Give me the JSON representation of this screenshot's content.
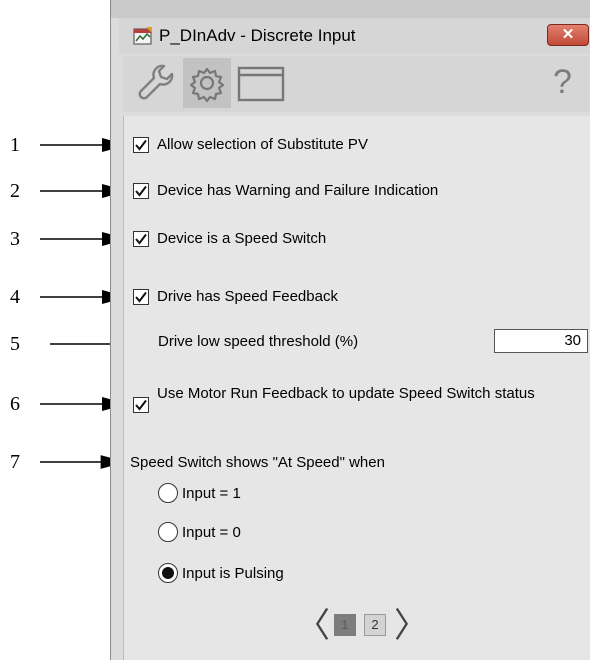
{
  "window": {
    "title": "P_DInAdv - Discrete Input",
    "close_label": "✕"
  },
  "tabs": [
    {
      "name": "maintenance",
      "icon": "wrench-icon",
      "active": false
    },
    {
      "name": "configuration",
      "icon": "gear-icon",
      "active": true
    },
    {
      "name": "display",
      "icon": "window-icon",
      "active": false
    }
  ],
  "help_label": "?",
  "callouts": [
    "1",
    "2",
    "3",
    "4",
    "5",
    "6",
    "7"
  ],
  "options": {
    "allow_substitute_pv": {
      "label": "Allow selection of Substitute PV",
      "checked": true
    },
    "warning_failure": {
      "label": "Device has Warning and Failure Indication",
      "checked": true
    },
    "speed_switch": {
      "label": "Device is a Speed Switch",
      "checked": true
    },
    "speed_feedback": {
      "label": "Drive has Speed Feedback",
      "checked": true
    },
    "low_speed_threshold": {
      "label": "Drive low speed threshold (%)",
      "value": "30"
    },
    "motor_run_feedback": {
      "label": "Use Motor Run Feedback to update Speed Switch status",
      "checked": true
    }
  },
  "at_speed": {
    "label": "Speed Switch shows \"At Speed\" when",
    "choices": [
      {
        "label": "Input = 1",
        "selected": false
      },
      {
        "label": "Input = 0",
        "selected": false
      },
      {
        "label": "Input is Pulsing",
        "selected": true
      }
    ]
  },
  "pager": {
    "prev": "〈",
    "next": "〉",
    "pages": [
      "1",
      "2"
    ],
    "current": "1"
  }
}
